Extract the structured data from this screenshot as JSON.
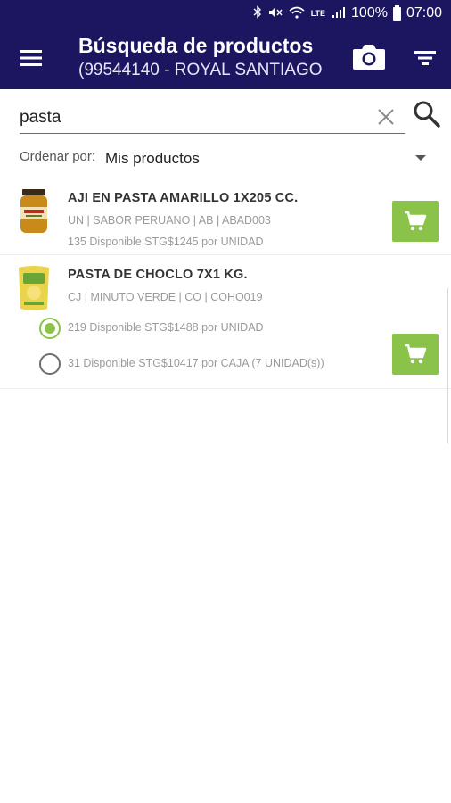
{
  "status_bar": {
    "battery": "100%",
    "time": "07:00",
    "network": "LTE",
    "icons": [
      "bluetooth-icon",
      "mute-icon",
      "wifi-icon",
      "signal-icon",
      "battery-icon"
    ]
  },
  "app_bar": {
    "title": "Búsqueda de productos",
    "subtitle": "(99544140 - ROYAL SANTIAGO",
    "color": "#1c1560",
    "icons": [
      "menu-icon",
      "camera-icon",
      "filter-icon"
    ]
  },
  "search": {
    "value": "pasta",
    "icons": [
      "clear-icon",
      "search-icon"
    ]
  },
  "sort": {
    "label": "Ordenar por:",
    "value": "Mis productos"
  },
  "products": [
    {
      "name": "AJI EN PASTA AMARILLO 1X205 CC.",
      "meta": "UN | SABOR PERUANO | AB | ABAD003",
      "stock": "135 Disponible STG$1245 por UNIDAD"
    },
    {
      "name": "PASTA DE CHOCLO 7X1 KG.",
      "meta": "CJ | MINUTO VERDE | CO | COHO019",
      "options": [
        {
          "label": "219 Disponible STG$1488 por UNIDAD",
          "selected": true
        },
        {
          "label": "31 Disponible STG$10417 por CAJA (7 UNIDAD(s))",
          "selected": false
        }
      ]
    }
  ],
  "accent_color": "#8bc34a"
}
